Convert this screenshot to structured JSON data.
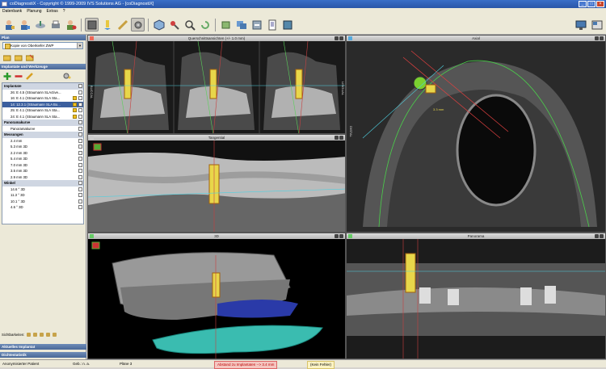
{
  "window": {
    "title": "coDiagnostiX - Copyright © 1999-2009 IVS Solutions AG - [coDiagnostiX]"
  },
  "menu": [
    "Datenbank",
    "Planung",
    "Extras",
    "?"
  ],
  "plan": {
    "header": "Plan",
    "selected": "Kopie von Oberkiefer ZWP"
  },
  "implants_panel": {
    "header": "Implantate und Werkzeuge"
  },
  "tree": [
    {
      "type": "group",
      "label": "Implantate"
    },
    {
      "type": "item",
      "label": "26: E 4.5 (Straumann SLActive..."
    },
    {
      "type": "item",
      "label": "16: E 4.1 (Straumann SLA Sta...",
      "warn": true
    },
    {
      "type": "item",
      "label": "14: 12.3.1 (Straumann SLA Bo...",
      "warn": true,
      "selected": true
    },
    {
      "type": "item",
      "label": "25: E 4.1 (Straumann SLA Sta...",
      "warn": true
    },
    {
      "type": "item",
      "label": "24: E 4.1 (Straumann SLA Sta...",
      "warn": true
    },
    {
      "type": "group",
      "label": "Panoramakurve"
    },
    {
      "type": "item",
      "label": "Panoramakurve"
    },
    {
      "type": "group",
      "label": "Messungen"
    },
    {
      "type": "item",
      "label": "2.4 mm"
    },
    {
      "type": "item",
      "label": "5.3 mm 3D"
    },
    {
      "type": "item",
      "label": "2.2 mm 3D"
    },
    {
      "type": "item",
      "label": "5.4 mm 3D"
    },
    {
      "type": "item",
      "label": "7.0 mm 3D"
    },
    {
      "type": "item",
      "label": "3.5 mm 3D"
    },
    {
      "type": "item",
      "label": "2.9 mm 3D"
    },
    {
      "type": "group",
      "label": "Winkel"
    },
    {
      "type": "item",
      "label": "14.6 ° 3D"
    },
    {
      "type": "item",
      "label": "11.3 ° 3D"
    },
    {
      "type": "item",
      "label": "10.1 ° 3D"
    },
    {
      "type": "item",
      "label": "4.6 ° 3D"
    }
  ],
  "visibility_label": "Sichtbarkeiten:",
  "sections": {
    "current_implant": "Aktuelles Implantat",
    "density": "Dichtestatistik"
  },
  "views": {
    "cross": "Querschnittsansichten (+/- 1.0 mm)",
    "axial": "Axial",
    "tangential": "Tangential",
    "three_d": "3D",
    "panorama": "Panorama",
    "cross_side_left": "BUCCAL",
    "cross_side_right": "LINGUAL",
    "axial_measure": "3.3 mm",
    "axial_side": "DISTAL"
  },
  "status": {
    "patient": "Anonymisierter Patient",
    "birth": "Geb.: n. a.",
    "plans": "Pläne 3",
    "warning": "Abstand zu Implantaten --> 3.4 mm",
    "empty": "(Kein Fehler)"
  },
  "colors": {
    "accent": "#3b5f9e",
    "implant": "#e8d64a",
    "warning": "#b00000"
  }
}
